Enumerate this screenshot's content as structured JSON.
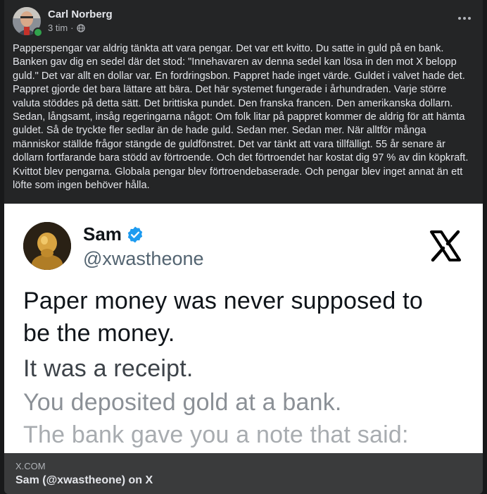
{
  "post": {
    "author": "Carl Norberg",
    "time": "3 tim",
    "separator": "·",
    "audience_icon": "globe-icon",
    "menu_icon": "more-dots-icon",
    "text": "Papperspengar var aldrig tänkta att vara pengar. Det var ett kvitto. Du satte in guld på en bank. Banken gav dig en sedel där det stod: \"Innehavaren av denna sedel kan lösa in den mot X belopp guld.\" Det var allt en dollar var. En fordringsbon. Pappret hade inget värde. Guldet i valvet hade det. Pappret gjorde det bara lättare att bära. Det här systemet fungerade i århundraden. Varje större valuta stöddes på detta sätt. Det brittiska pundet. Den franska francen. Den amerikanska dollarn. Sedan, långsamt, insåg regeringarna något: Om folk litar på pappret kommer de aldrig för att hämta guldet. Så de tryckte fler sedlar än de hade guld. Sedan mer. Sedan mer. När alltför många människor ställde frågor stängde de guldfönstret. Det var tänkt att vara tillfälligt. 55 år senare är dollarn fortfarande bara stödd av förtroende. Och det förtroendet har kostat dig 97 % av din köpkraft. Kvittot blev pengarna. Globala pengar blev förtroendebaserade. Och pengar blev inget annat än ett löfte som ingen behöver hålla."
  },
  "embed": {
    "name": "Sam",
    "handle": "@xwastheone",
    "verified_icon": "verified-badge-icon",
    "platform_icon": "x-logo-icon",
    "lines": [
      "Paper money was never supposed to",
      "be the money.",
      "It was a receipt.",
      "You deposited gold at a bank.",
      "The bank gave you a note that said:"
    ]
  },
  "link": {
    "domain": "X.COM",
    "title": "Sam (@xwastheone) on X"
  },
  "colors": {
    "page_bg": "#18191a",
    "card_bg": "#242526",
    "text_primary": "#e4e6eb",
    "text_secondary": "#b0b3b8",
    "link_bar_bg": "#3a3b3c",
    "online": "#31a24c",
    "verified_blue": "#1d9bf0"
  }
}
